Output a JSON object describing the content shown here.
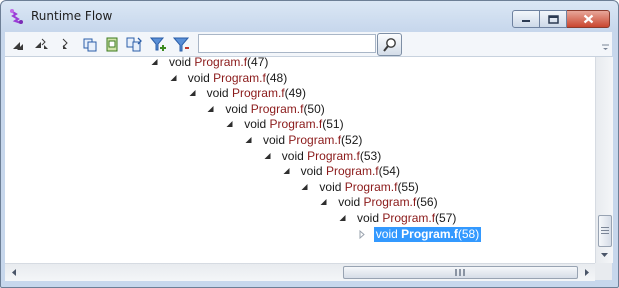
{
  "window": {
    "title": "Runtime Flow"
  },
  "toolbar": {
    "icons": [
      "collapse-all-icon",
      "expand-icon",
      "step-icon",
      "copy-icon",
      "paste-icon",
      "refresh-icon",
      "add-filter-icon",
      "filter-icon"
    ],
    "search": {
      "value": "",
      "placeholder": ""
    }
  },
  "tree": {
    "rows": [
      {
        "kw": "void",
        "cls": "Program.f",
        "num": "(47)"
      },
      {
        "kw": "void",
        "cls": "Program.f",
        "num": "(48)"
      },
      {
        "kw": "void",
        "cls": "Program.f",
        "num": "(49)"
      },
      {
        "kw": "void",
        "cls": "Program.f",
        "num": "(50)"
      },
      {
        "kw": "void",
        "cls": "Program.f",
        "num": "(51)"
      },
      {
        "kw": "void",
        "cls": "Program.f",
        "num": "(52)"
      },
      {
        "kw": "void",
        "cls": "Program.f",
        "num": "(53)"
      },
      {
        "kw": "void",
        "cls": "Program.f",
        "num": "(54)"
      },
      {
        "kw": "void",
        "cls": "Program.f",
        "num": "(55)"
      },
      {
        "kw": "void",
        "cls": "Program.f",
        "num": "(56)"
      },
      {
        "kw": "void",
        "cls": "Program.f",
        "num": "(57)"
      },
      {
        "kw": "void",
        "cls": "Program.f",
        "num": "(58)",
        "selected": true,
        "collapsed": true
      }
    ]
  },
  "colors": {
    "selection": "#3399ff",
    "type_name": "#8b1a1a"
  }
}
